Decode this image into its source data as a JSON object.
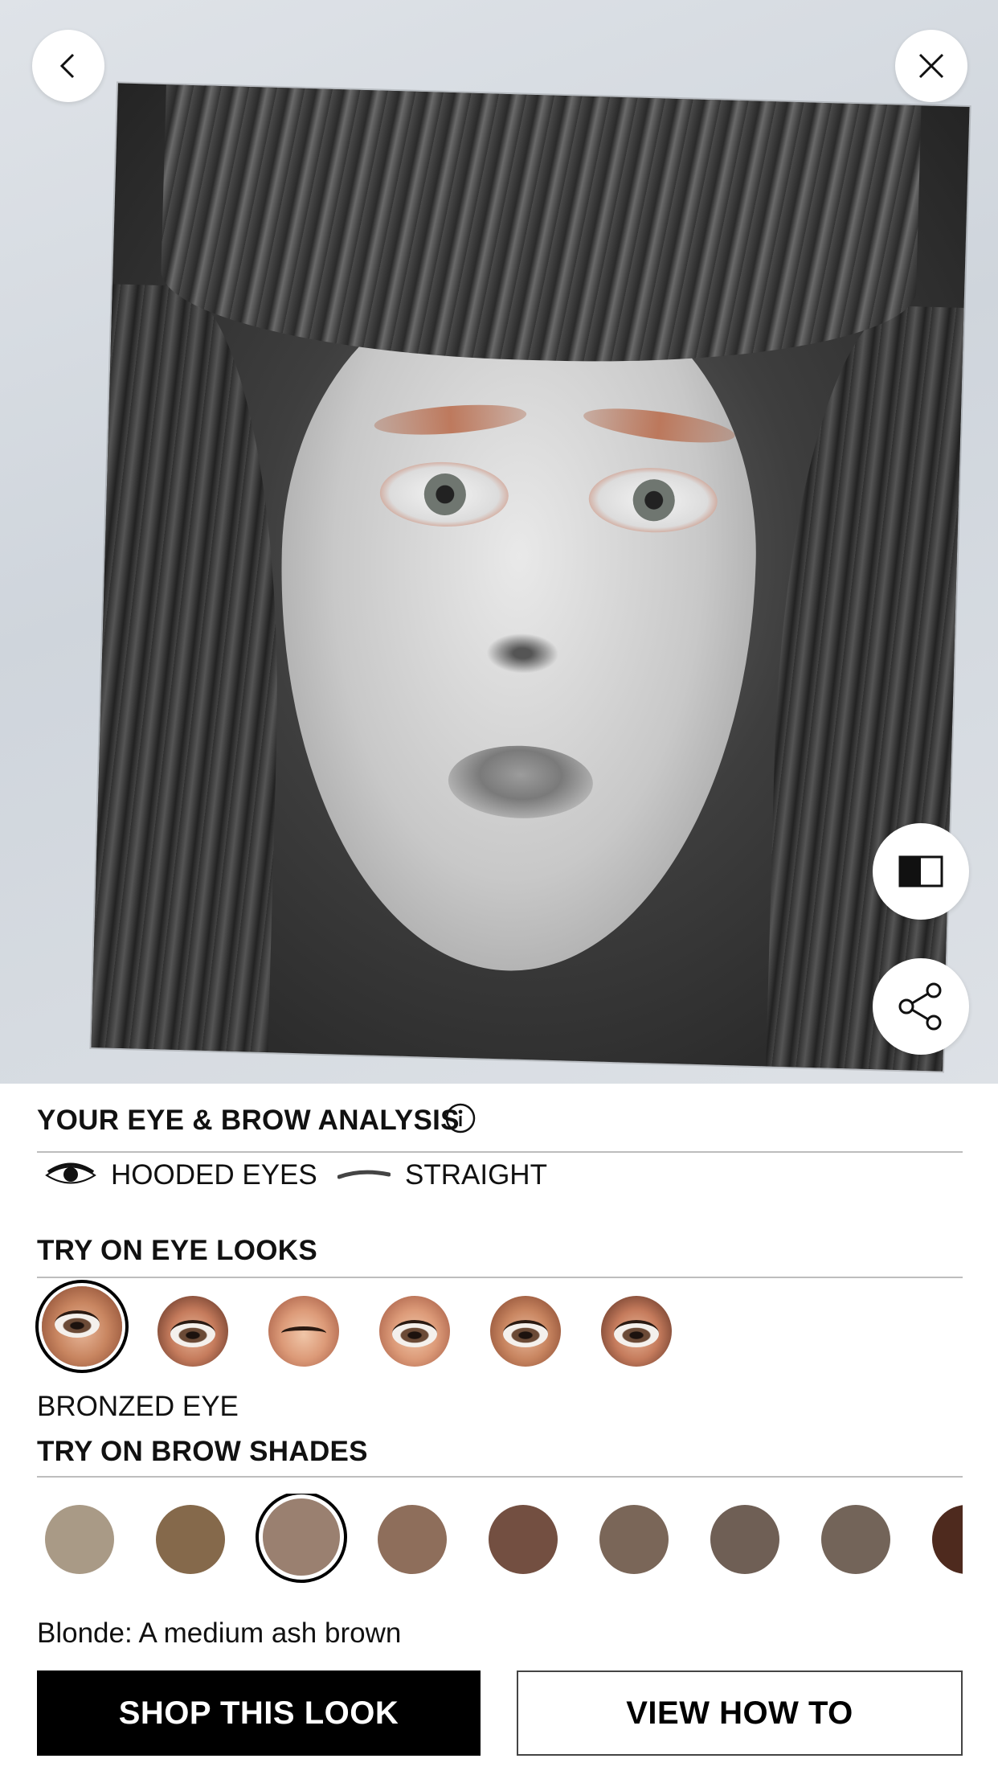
{
  "camera": {
    "back_icon": "chevron-left-icon",
    "close_icon": "close-icon",
    "compare_icon": "split-compare-icon",
    "share_icon": "share-icon"
  },
  "analysis": {
    "title": "YOUR EYE & BROW ANALYSIS",
    "info_icon": "info-icon",
    "eye_shape": "HOODED EYES",
    "brow_shape": "STRAIGHT"
  },
  "eye_looks": {
    "title": "TRY ON EYE LOOKS",
    "selected_name": "BRONZED EYE",
    "selected_index": 0,
    "count": 6
  },
  "brow_shades": {
    "title": "TRY ON BROW SHADES",
    "selected_index": 2,
    "colors": [
      "#a99a86",
      "#85694b",
      "#9a8070",
      "#8e6e5b",
      "#734f41",
      "#7a6658",
      "#6f5f55",
      "#736459",
      "#4e2a1e"
    ],
    "description": "Blonde: A medium ash brown"
  },
  "actions": {
    "shop_label": "SHOP THIS LOOK",
    "view_label": "VIEW HOW TO"
  }
}
